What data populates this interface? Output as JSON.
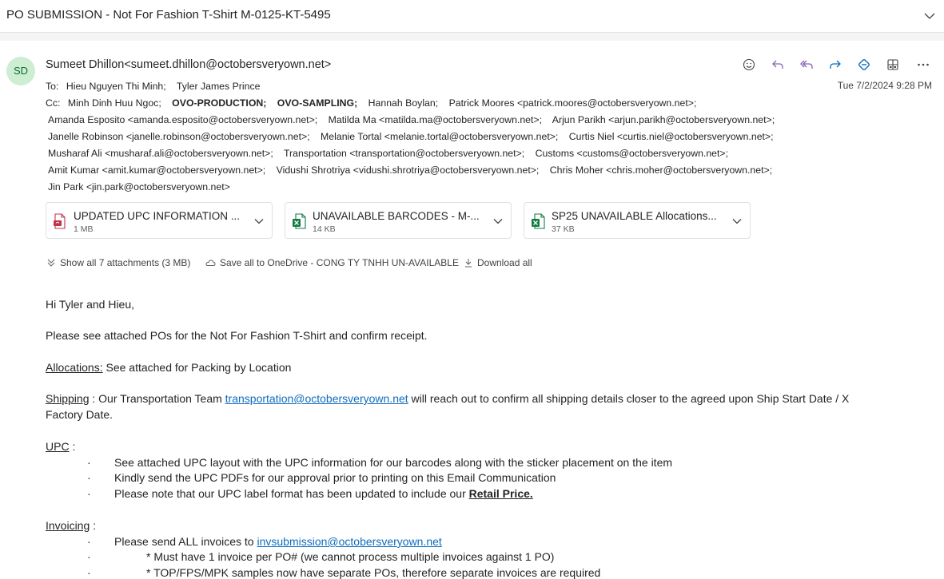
{
  "subject": "PO SUBMISSION - Not For Fashion T-Shirt M-0125-KT-5495",
  "sender": {
    "initials": "SD",
    "display": "Sumeet Dhillon<sumeet.dhillon@octobersveryown.net>"
  },
  "date": "Tue 7/2/2024 9:28 PM",
  "to_label": "To:",
  "to": [
    "Hieu Nguyen Thi Minh;",
    "Tyler James Prince"
  ],
  "cc_label": "Cc:",
  "cc_line1": [
    {
      "t": "Minh Dinh Huu Ngoc;",
      "bold": false
    },
    {
      "t": "OVO-PRODUCTION;",
      "bold": true
    },
    {
      "t": "OVO-SAMPLING;",
      "bold": true
    },
    {
      "t": "Hannah Boylan;",
      "bold": false
    },
    {
      "t": "Patrick Moores <patrick.moores@octobersveryown.net>;",
      "bold": false
    }
  ],
  "cc_line2": [
    "Amanda Esposito <amanda.esposito@octobersveryown.net>;",
    "Matilda Ma <matilda.ma@octobersveryown.net>;",
    "Arjun Parikh <arjun.parikh@octobersveryown.net>;"
  ],
  "cc_line3": [
    "Janelle Robinson <janelle.robinson@octobersveryown.net>;",
    "Melanie Tortal <melanie.tortal@octobersveryown.net>;",
    "Curtis Niel <curtis.niel@octobersveryown.net>;"
  ],
  "cc_line4": [
    "Musharaf Ali <musharaf.ali@octobersveryown.net>;",
    "Transportation <transportation@octobersveryown.net>;",
    "Customs <customs@octobersveryown.net>;"
  ],
  "cc_line5": [
    "Amit Kumar <amit.kumar@octobersveryown.net>;",
    "Vidushi Shrotriya <vidushi.shrotriya@octobersveryown.net>;",
    "Chris Moher <chris.moher@octobersveryown.net>;"
  ],
  "cc_line6": [
    "Jin Park <jin.park@octobersveryown.net>"
  ],
  "attachments": [
    {
      "name": "UPDATED UPC INFORMATION ...",
      "size": "1 MB",
      "icon": "pdf-file-icon"
    },
    {
      "name": "UNAVAILABLE BARCODES - M-...",
      "size": "14 KB",
      "icon": "excel-file-icon"
    },
    {
      "name": "SP25 UNAVAILABLE Allocations...",
      "size": "37 KB",
      "icon": "excel-file-icon"
    }
  ],
  "attachment_actions": {
    "show_all": "Show all 7 attachments (3 MB)",
    "save_onedrive": "Save all to OneDrive - CONG TY TNHH UN-AVAILABLE",
    "download_all": "Download all"
  },
  "body": {
    "greeting": "Hi Tyler and Hieu,",
    "intro": "Please see attached POs for the Not For Fashion T-Shirt and confirm receipt.",
    "alloc_label": "Allocations:",
    "alloc_text": " See attached for Packing by Location",
    "ship_label": "Shipping",
    "ship_pre": " : Our Transportation Team ",
    "ship_link": "transportation@octobersveryown.net",
    "ship_post": " will reach out to confirm all shipping details closer to the agreed upon Ship Start Date / X",
    "ship_line2": "Factory Date.",
    "upc_label": "UPC",
    "upc_colon": " :",
    "bullet_char": "·",
    "upc_b1": "See attached UPC layout with the UPC information for our barcodes along with the sticker placement on the item",
    "upc_b2": "Kindly send the UPC PDFs for our approval prior to printing on this Email Communication",
    "upc_b3_pre": "Please note that our UPC label format has been updated to include our ",
    "upc_b3_bold": "Retail Price.",
    "inv_label": "Invoicing",
    "inv_colon": " :",
    "inv_b1_pre": "Please send ALL invoices to ",
    "inv_b1_link": "invsubmission@octobersveryown.net",
    "inv_b2": "* Must have 1 invoice per PO# (we cannot process multiple invoices against 1 PO)",
    "inv_b3": "* TOP/FPS/MPK samples now have separate POs, therefore separate invoices are required"
  },
  "colors": {
    "accent": "#0f6cbd",
    "avatar_bg": "#cdeed2",
    "avatar_fg": "#0e6b2f",
    "pdf_red": "#c4314b",
    "excel_green": "#107c41",
    "action_purple": "#8764b8"
  }
}
